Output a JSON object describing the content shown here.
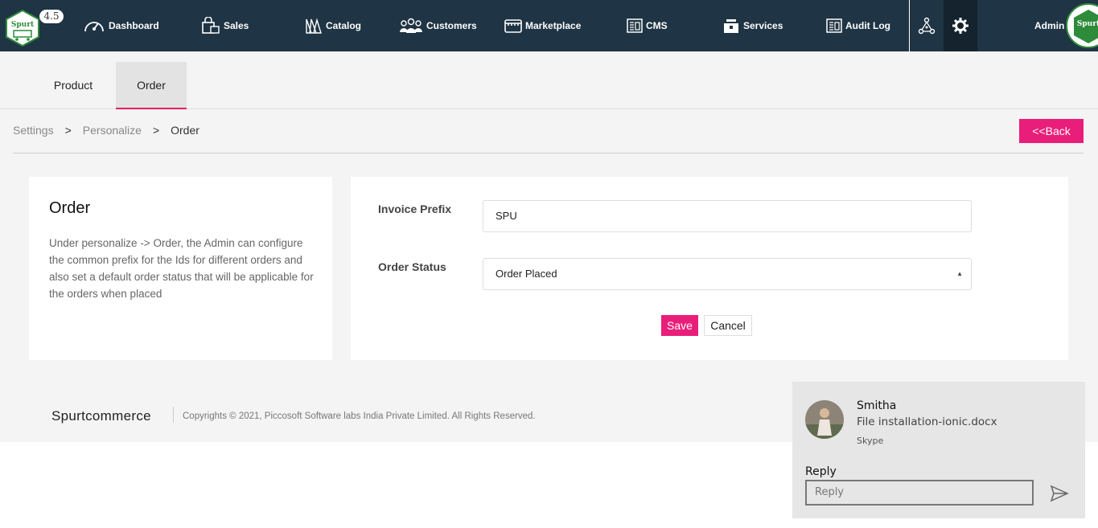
{
  "header": {
    "version": "4.5",
    "nav": [
      {
        "label": "Dashboard",
        "icon": "dashboard-icon"
      },
      {
        "label": "Sales",
        "icon": "shopping-bag-icon"
      },
      {
        "label": "Catalog",
        "icon": "catalog-icon"
      },
      {
        "label": "Customers",
        "icon": "customers-icon"
      },
      {
        "label": "Marketplace",
        "icon": "marketplace-icon"
      },
      {
        "label": "CMS",
        "icon": "cms-icon"
      },
      {
        "label": "Services",
        "icon": "services-icon"
      },
      {
        "label": "Audit Log",
        "icon": "audit-log-icon"
      }
    ],
    "user": "Admin",
    "brand_color": "#1f3444",
    "accent_color": "#e91e7a"
  },
  "tabs": [
    {
      "label": "Product",
      "active": false
    },
    {
      "label": "Order",
      "active": true
    }
  ],
  "breadcrumb": {
    "items": [
      "Settings",
      "Personalize",
      "Order"
    ],
    "separator": ">"
  },
  "back_label": "<<Back",
  "info": {
    "title": "Order",
    "description": "Under personalize -> Order, the Admin can configure the common prefix for the Ids for different orders and also set a default order status that will be applicable for the orders when placed"
  },
  "form": {
    "invoice_prefix_label": "Invoice Prefix",
    "invoice_prefix_value": "SPU",
    "order_status_label": "Order Status",
    "order_status_value": "Order Placed",
    "save_label": "Save",
    "cancel_label": "Cancel"
  },
  "footer": {
    "brand": "Spurtcommerce",
    "copyright": "Copyrights © 2021, Piccosoft Software labs India Private Limited. All Rights Reserved."
  },
  "notification": {
    "name": "Smitha",
    "message": "File installation-ionic.docx",
    "app": "Skype",
    "reply_label": "Reply",
    "reply_placeholder": "Reply"
  }
}
